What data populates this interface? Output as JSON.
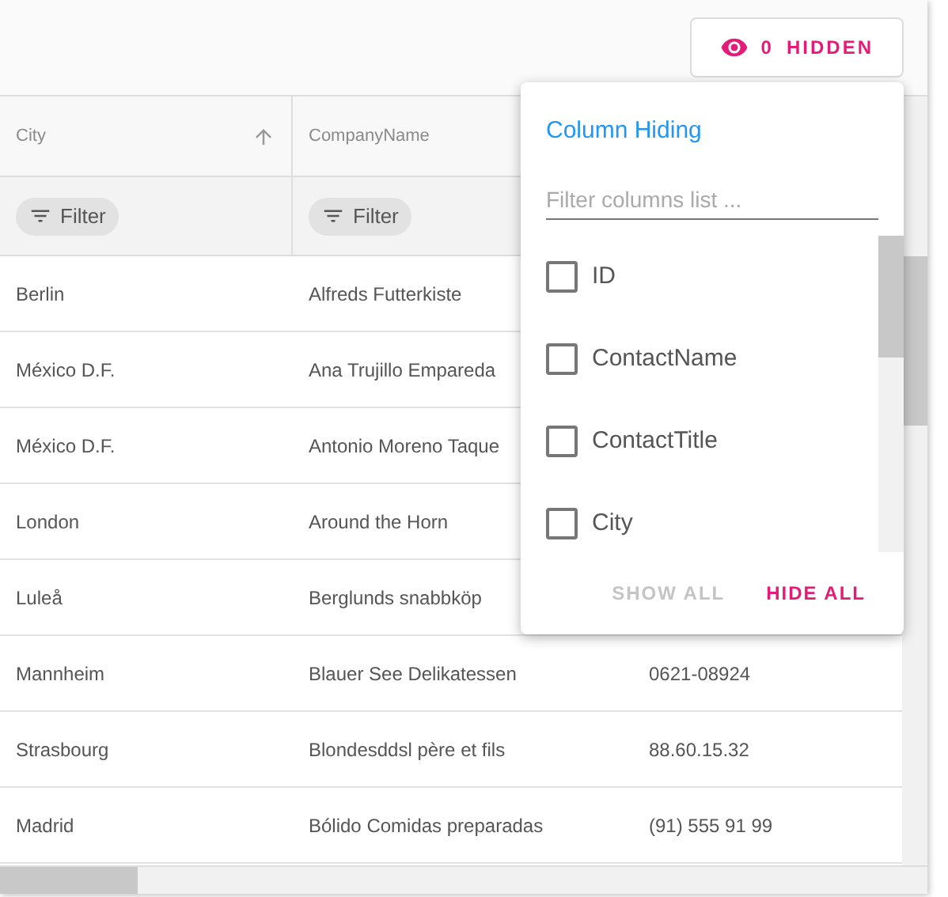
{
  "toolbar": {
    "hidden_button": {
      "count": "0",
      "label": "HIDDEN"
    }
  },
  "table": {
    "columns": [
      {
        "label": "City",
        "sort_ascending": true,
        "filter": "Filter"
      },
      {
        "label": "CompanyName",
        "filter": "Filter"
      }
    ],
    "rows": [
      {
        "cells": [
          "Berlin",
          "Alfreds Futterkiste"
        ]
      },
      {
        "cells": [
          "México D.F.",
          "Ana Trujillo Empareda"
        ]
      },
      {
        "cells": [
          "México D.F.",
          "Antonio Moreno Taque"
        ]
      },
      {
        "cells": [
          "London",
          "Around the Horn"
        ]
      },
      {
        "cells": [
          "Luleå",
          "Berglunds snabbköp"
        ]
      },
      {
        "cells": [
          "Mannheim",
          "Blauer See Delikatessen",
          "0621-08924"
        ]
      },
      {
        "cells": [
          "Strasbourg",
          "Blondesddsl père et fils",
          "88.60.15.32"
        ]
      },
      {
        "cells": [
          "Madrid",
          "Bólido Comidas preparadas",
          "(91) 555 91 99"
        ]
      }
    ]
  },
  "column_hiding": {
    "title": "Column Hiding",
    "search": {
      "placeholder": "Filter columns list ..."
    },
    "columns": [
      {
        "label": "ID",
        "checked": false
      },
      {
        "label": "ContactName",
        "checked": false
      },
      {
        "label": "ContactTitle",
        "checked": false
      },
      {
        "label": "City",
        "checked": false
      }
    ],
    "buttons": [
      {
        "label": "SHOW ALL",
        "disabled": true
      },
      {
        "label": "HIDE ALL",
        "disabled": false
      }
    ]
  }
}
